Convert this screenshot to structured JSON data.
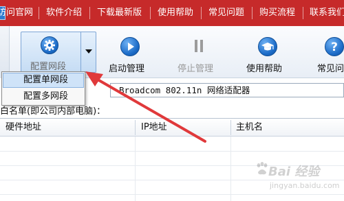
{
  "menubar": {
    "bg": "#c62a2a",
    "items": [
      "访问官网",
      "软件介绍",
      "下载最新版",
      "使用帮助",
      "常见问题",
      "购买流程",
      "联系我们"
    ]
  },
  "toolbar": {
    "config_button_label": "配置网段",
    "start_label": "启动管理",
    "stop_label": "停止管理",
    "help_label": "使用帮助",
    "faq_label": "常见问"
  },
  "dropdown": {
    "items": [
      "配置单网段",
      "配置多网段"
    ],
    "highlighted_index": 0
  },
  "adapter": {
    "value": "Broadcom 802.11n 网络适配器"
  },
  "whitelist": {
    "label": "白名单(即公司内部电脑)："
  },
  "table": {
    "columns": [
      "硬件地址",
      "IP地址",
      "主机名"
    ],
    "rows": []
  },
  "annotation": {
    "arrow_color": "#e0393b"
  },
  "watermark": {
    "brand": "Bai 经验",
    "url": "jingyan.baidu.com"
  }
}
